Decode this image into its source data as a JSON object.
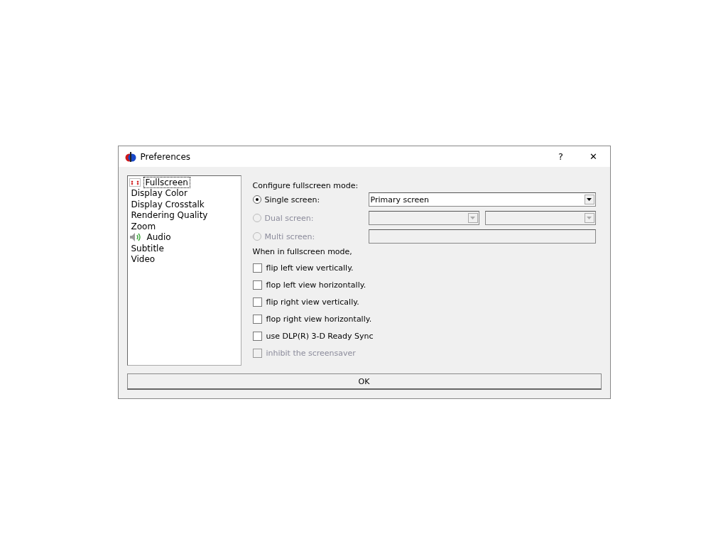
{
  "window": {
    "title": "Preferences",
    "help_button": "?",
    "close_button": "✕"
  },
  "sidebar": {
    "items": [
      {
        "label": "Fullscreen",
        "kind": "screen",
        "selected": true
      },
      {
        "label": "Display Color",
        "kind": "plain",
        "selected": false
      },
      {
        "label": "Display Crosstalk",
        "kind": "plain",
        "selected": false
      },
      {
        "label": "Rendering Quality",
        "kind": "plain",
        "selected": false
      },
      {
        "label": "Zoom",
        "kind": "plain",
        "selected": false
      },
      {
        "label": "Audio",
        "kind": "speaker",
        "selected": false
      },
      {
        "label": "Subtitle",
        "kind": "plain",
        "selected": false
      },
      {
        "label": "Video",
        "kind": "plain",
        "selected": false
      }
    ]
  },
  "panel": {
    "heading": "Configure fullscreen mode:",
    "modes": [
      {
        "label": "Single screen:",
        "selected": true,
        "disabled": false,
        "kind": "one-dropdown",
        "value": "Primary screen"
      },
      {
        "label": "Dual screen:",
        "selected": false,
        "disabled": true,
        "kind": "two-dropdowns"
      },
      {
        "label": "Multi screen:",
        "selected": false,
        "disabled": true,
        "kind": "text-field"
      }
    ],
    "subheading": "When in fullscreen mode,",
    "options": [
      {
        "label": "flip left view vertically.",
        "checked": false,
        "disabled": false
      },
      {
        "label": "flop left view horizontally.",
        "checked": false,
        "disabled": false
      },
      {
        "label": "flip right view vertically.",
        "checked": false,
        "disabled": false
      },
      {
        "label": "flop right view horizontally.",
        "checked": false,
        "disabled": false
      },
      {
        "label": "use DLP(R) 3-D Ready Sync",
        "checked": false,
        "disabled": false
      },
      {
        "label": "inhibit the screensaver",
        "checked": false,
        "disabled": true
      }
    ]
  },
  "buttons": {
    "ok": "OK"
  }
}
